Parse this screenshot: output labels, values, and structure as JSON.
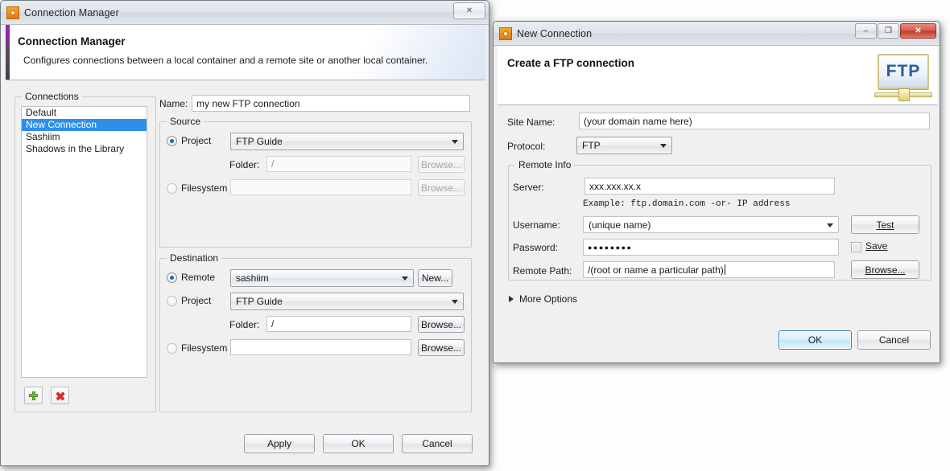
{
  "connection_manager": {
    "title": "Connection Manager",
    "titlebar_icon": "gear-icon",
    "close_label": "✕",
    "banner": {
      "heading": "Connection Manager",
      "description": "Configures connections between a local container and a remote site or another local container."
    },
    "connections_group_label": "Connections",
    "connections": [
      {
        "label": "Default",
        "selected": false
      },
      {
        "label": "New Connection",
        "selected": true
      },
      {
        "label": "Sashiim",
        "selected": false
      },
      {
        "label": "Shadows in the Library",
        "selected": false
      }
    ],
    "add_button_label": "+",
    "remove_button_label": "✕",
    "name_label": "Name:",
    "name_value": "my new FTP connection",
    "source": {
      "group_label": "Source",
      "project_radio_label": "Project",
      "project_selected": true,
      "project_value": "FTP Guide",
      "folder_label": "Folder:",
      "folder_value": "/",
      "folder_browse_label": "Browse...",
      "filesystem_radio_label": "Filesystem",
      "filesystem_selected": false,
      "filesystem_value": "",
      "filesystem_browse_label": "Browse..."
    },
    "destination": {
      "group_label": "Destination",
      "remote_radio_label": "Remote",
      "remote_selected": true,
      "remote_value": "sashiim",
      "new_button_label": "New...",
      "project_radio_label": "Project",
      "project_selected": false,
      "project_value": "FTP Guide",
      "folder_label": "Folder:",
      "folder_value": "/",
      "folder_browse_label": "Browse...",
      "filesystem_radio_label": "Filesystem",
      "filesystem_selected": false,
      "filesystem_value": "",
      "filesystem_browse_label": "Browse..."
    },
    "footer": {
      "apply_label": "Apply",
      "ok_label": "OK",
      "cancel_label": "Cancel"
    }
  },
  "new_connection": {
    "title": "New Connection",
    "titlebar_icon": "gear-icon",
    "minimize_label": "–",
    "maximize_label": "❐",
    "close_label": "✕",
    "banner": {
      "heading": "Create a FTP connection",
      "logo_text": "FTP"
    },
    "site_name_label": "Site Name:",
    "site_name_value": "(your domain name here)",
    "protocol_label": "Protocol:",
    "protocol_value": "FTP",
    "remote_info": {
      "group_label": "Remote Info",
      "server_label": "Server:",
      "server_value": "xxx.xxx.xx.x",
      "server_hint": "Example: ftp.domain.com -or- IP address",
      "username_label": "Username:",
      "username_value": "(unique name)",
      "test_button_label": "Test",
      "password_label": "Password:",
      "password_value": "●●●●●●●●",
      "save_checkbox_label": "Save",
      "save_checked": false,
      "remote_path_label": "Remote Path:",
      "remote_path_value": "/(root or name a particular path)",
      "browse_button_label": "Browse..."
    },
    "more_options_label": "More Options",
    "footer": {
      "ok_label": "OK",
      "cancel_label": "Cancel"
    }
  },
  "colors": {
    "selection_blue": "#2f8fe8",
    "accent_purple": "#a21fb8",
    "default_button_blue": "#3c7fb1",
    "close_red": "#d75a4a"
  }
}
